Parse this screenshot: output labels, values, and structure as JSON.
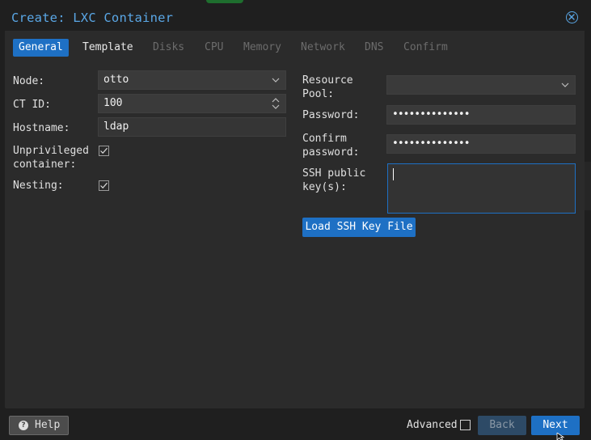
{
  "dialog": {
    "title": "Create: LXC Container"
  },
  "tabs": [
    {
      "label": "General",
      "state": "active"
    },
    {
      "label": "Template",
      "state": "enabled"
    },
    {
      "label": "Disks",
      "state": "disabled"
    },
    {
      "label": "CPU",
      "state": "disabled"
    },
    {
      "label": "Memory",
      "state": "disabled"
    },
    {
      "label": "Network",
      "state": "disabled"
    },
    {
      "label": "DNS",
      "state": "disabled"
    },
    {
      "label": "Confirm",
      "state": "disabled"
    }
  ],
  "left": {
    "node_label": "Node:",
    "node_value": "otto",
    "ctid_label": "CT ID:",
    "ctid_value": "100",
    "hostname_label": "Hostname:",
    "hostname_value": "ldap",
    "unprivileged_label_1": "Unprivileged",
    "unprivileged_label_2": "container:",
    "unprivileged_checked": true,
    "nesting_label": "Nesting:",
    "nesting_checked": true
  },
  "right": {
    "pool_label_1": "Resource",
    "pool_label_2": "Pool:",
    "pool_value": "",
    "password_label": "Password:",
    "password_value": "••••••••••••••",
    "confirm_label_1": "Confirm",
    "confirm_label_2": "password:",
    "confirm_value": "••••••••••••••",
    "ssh_label_1": "SSH public",
    "ssh_label_2": "key(s):",
    "ssh_value": "",
    "load_ssh_button": "Load SSH Key File"
  },
  "footer": {
    "help_label": "Help",
    "help_icon_glyph": "?",
    "advanced_label": "Advanced",
    "advanced_checked": false,
    "back_label": "Back",
    "next_label": "Next"
  },
  "colors": {
    "accent": "#1e70c4",
    "title": "#5aa7e6",
    "panel": "#2b2b2b",
    "field": "#3a3a3a"
  }
}
